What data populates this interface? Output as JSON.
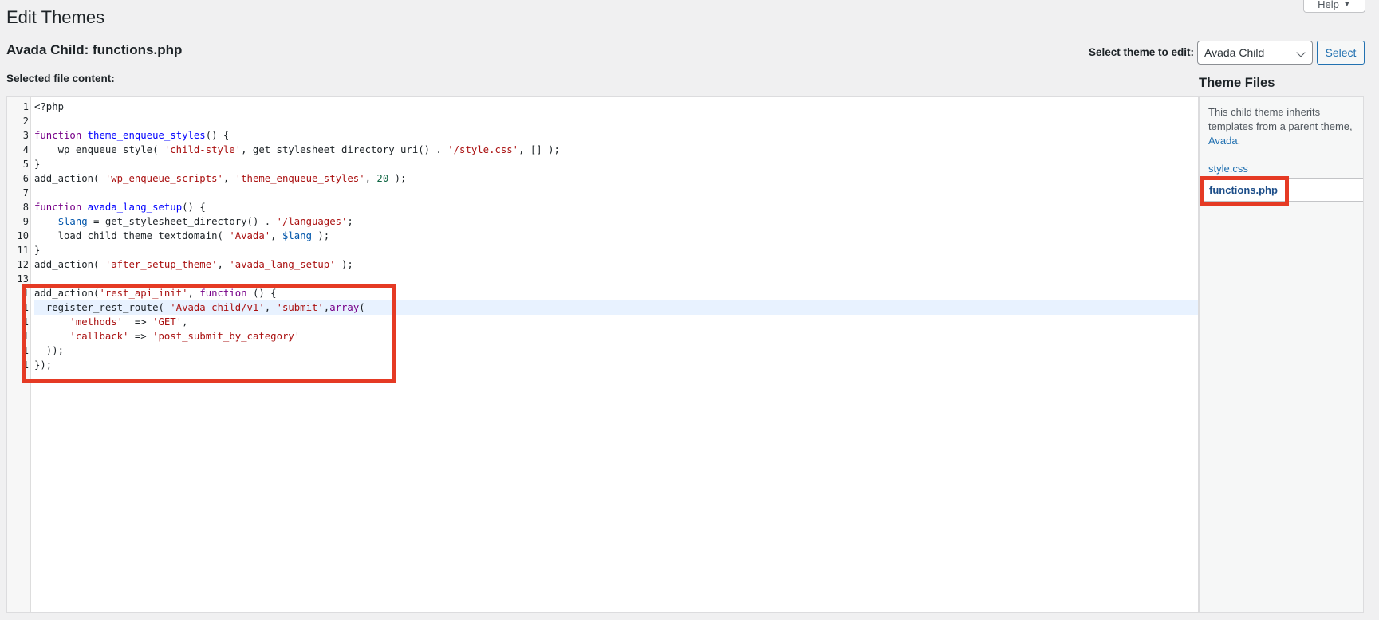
{
  "header": {
    "title": "Edit Themes",
    "help_label": "Help",
    "help_caret": "▼"
  },
  "file_heading": "Avada Child: functions.php",
  "theme_selector": {
    "label": "Select theme to edit:",
    "value": "Avada Child",
    "button_label": "Select"
  },
  "editor": {
    "label": "Selected file content:",
    "line_numbers": [
      "1",
      "2",
      "3",
      "4",
      "5",
      "6",
      "7",
      "8",
      "9",
      "10",
      "11",
      "12",
      "13",
      "1",
      "1",
      "1",
      "1",
      "1",
      "1"
    ],
    "lines": [
      [
        {
          "t": "<?php",
          "c": ""
        }
      ],
      [],
      [
        {
          "t": "function ",
          "c": "kw"
        },
        {
          "t": "theme_enqueue_styles",
          "c": "def"
        },
        {
          "t": "() {",
          "c": ""
        }
      ],
      [
        {
          "t": "    wp_enqueue_style( ",
          "c": ""
        },
        {
          "t": "'child-style'",
          "c": "str"
        },
        {
          "t": ", get_stylesheet_directory_uri() . ",
          "c": ""
        },
        {
          "t": "'/style.css'",
          "c": "str"
        },
        {
          "t": ", [] );",
          "c": ""
        }
      ],
      [
        {
          "t": "}",
          "c": ""
        }
      ],
      [
        {
          "t": "add_action( ",
          "c": ""
        },
        {
          "t": "'wp_enqueue_scripts'",
          "c": "str"
        },
        {
          "t": ", ",
          "c": ""
        },
        {
          "t": "'theme_enqueue_styles'",
          "c": "str"
        },
        {
          "t": ", ",
          "c": ""
        },
        {
          "t": "20",
          "c": "num"
        },
        {
          "t": " );",
          "c": ""
        }
      ],
      [],
      [
        {
          "t": "function ",
          "c": "kw"
        },
        {
          "t": "avada_lang_setup",
          "c": "def"
        },
        {
          "t": "() {",
          "c": ""
        }
      ],
      [
        {
          "t": "    ",
          "c": ""
        },
        {
          "t": "$lang",
          "c": "var"
        },
        {
          "t": " = get_stylesheet_directory() . ",
          "c": ""
        },
        {
          "t": "'/languages'",
          "c": "str"
        },
        {
          "t": ";",
          "c": ""
        }
      ],
      [
        {
          "t": "    load_child_theme_textdomain( ",
          "c": ""
        },
        {
          "t": "'Avada'",
          "c": "str"
        },
        {
          "t": ", ",
          "c": ""
        },
        {
          "t": "$lang",
          "c": "var"
        },
        {
          "t": " );",
          "c": ""
        }
      ],
      [
        {
          "t": "}",
          "c": ""
        }
      ],
      [
        {
          "t": "add_action( ",
          "c": ""
        },
        {
          "t": "'after_setup_theme'",
          "c": "str"
        },
        {
          "t": ", ",
          "c": ""
        },
        {
          "t": "'avada_lang_setup'",
          "c": "str"
        },
        {
          "t": " );",
          "c": ""
        }
      ],
      [],
      [
        {
          "t": "add_action(",
          "c": ""
        },
        {
          "t": "'rest_api_init'",
          "c": "str"
        },
        {
          "t": ", ",
          "c": ""
        },
        {
          "t": "function",
          "c": "kw"
        },
        {
          "t": " () {",
          "c": ""
        }
      ],
      [
        {
          "t": "  register_rest_route( ",
          "c": ""
        },
        {
          "t": "'Avada-child/v1'",
          "c": "str"
        },
        {
          "t": ", ",
          "c": ""
        },
        {
          "t": "'submit'",
          "c": "str"
        },
        {
          "t": ",",
          "c": ""
        },
        {
          "t": "array",
          "c": "kw"
        },
        {
          "t": "(",
          "c": ""
        }
      ],
      [
        {
          "t": "      ",
          "c": ""
        },
        {
          "t": "'methods'",
          "c": "str"
        },
        {
          "t": "  => ",
          "c": ""
        },
        {
          "t": "'GET'",
          "c": "str"
        },
        {
          "t": ",",
          "c": ""
        }
      ],
      [
        {
          "t": "      ",
          "c": ""
        },
        {
          "t": "'callback'",
          "c": "str"
        },
        {
          "t": " => ",
          "c": ""
        },
        {
          "t": "'post_submit_by_category'",
          "c": "str"
        }
      ],
      [
        {
          "t": "  ));",
          "c": ""
        }
      ],
      [
        {
          "t": "});",
          "c": ""
        }
      ]
    ],
    "active_line_index": 14
  },
  "sidebar": {
    "title": "Theme Files",
    "note_text": "This child theme inherits templates from a parent theme, ",
    "parent_link": "Avada",
    "note_end": ".",
    "files": [
      "style.css",
      "functions.php"
    ],
    "current_file": "functions.php"
  },
  "colors": {
    "highlight_box": "#e53a24",
    "link": "#2271b1",
    "active_line_bg": "#e8f2ff"
  }
}
